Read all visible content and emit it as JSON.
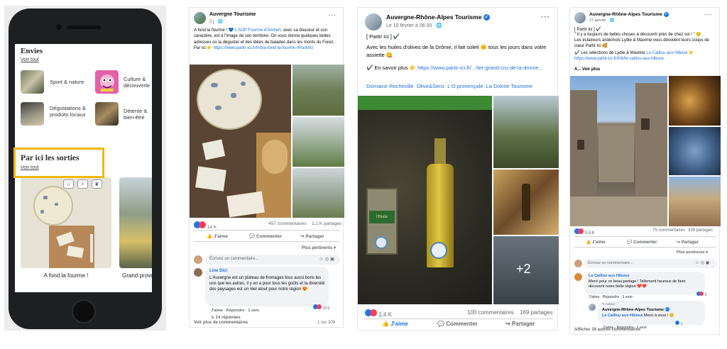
{
  "phone": {
    "section1_title": "Envies",
    "section1_link": "Voir tout",
    "categories": [
      {
        "label": "Sport & nature"
      },
      {
        "label": "Culture & découverte"
      },
      {
        "label": "Dégustations & produits locaux"
      },
      {
        "label": "Détente & bien-être"
      }
    ],
    "section2_title": "Par ici les sorties",
    "section2_link": "Voir tout",
    "card1_caption": "A fond la fourme !",
    "card2_caption": "Grand provença"
  },
  "post1": {
    "page_name": "Auvergne Tourisme",
    "date": "2 j · 🌐",
    "text_a": "A fond la fourme ! 💙 ",
    "text_link1": "L'AOP Fourme d'Ambert",
    "text_b": ", avec sa douceur et son caractère, est à l'image de son territoire. On vous donne quelques belles adresses où la déguster et des idées de balades dans les monts du Forez. Par ici 👉 ",
    "text_link2": "https://www.partir-ici.fr/fr/b/a-fond-la-fourme-#PartirIci",
    "reactions_count": "14 K",
    "comments": "457 commentaires",
    "shares": "1,1 K partages",
    "like": "J'aime",
    "comment": "Commenter",
    "share": "Partager",
    "sort": "Plus pertinents ▾",
    "write_placeholder": "Écrivez un commentaire...",
    "commenter": "Line Dici",
    "comment_text": "L'Auvergne est un plateau de fromages tous aussi bons les uns que les autres, il y en a pour tous les goûts et la diversité des paysages est un réel atout pour notre région 😍",
    "comment_actions": "J'aime · Répondre · 1 sem",
    "comment_react": "101",
    "replies": "↳ 14 réponses",
    "see_more": "Voir plus de commentaires",
    "pager": "1 sur 209"
  },
  "post2": {
    "page_name": "Auvergne-Rhône-Alpes Tourisme",
    "date": "Le 10 février à 06:30 · 🌐",
    "line1": "[ Partir Ici ] ✔️",
    "line2": "Avec les huiles d'olives de la Drôme, il fait soleil 🌞 tous les jours dans votre assiette 😋",
    "line3_a": "✔️ En savoir plus 👉 ",
    "line3_link": "https://www.partir-ici.fr/.../ter-grand-cru-de-la-drome...",
    "tags": "Domaine Rocheville  Olive&Sens  L'O provençale  La Drôme Tourisme",
    "bottle_label": "l'Huile",
    "more_photos": "+2",
    "reactions_count": "1,4 K",
    "comments": "100 commentaires",
    "shares": "169 partages",
    "like": "J'aime",
    "comment": "Commenter",
    "share": "Partager"
  },
  "post3": {
    "page_name": "Auvergne-Rhône-Alpes Tourisme",
    "date": "27 janvier · 🌐",
    "line1": "[ Partir Ici ] ✔️",
    "line2": "\" Il y a toujours de belles choses à découvrir près de chez soi ! \" 😊",
    "line3": "Les éclaireurs ardéchois Lydie & Maxime vous dévoilent leurs coups de cœur Partir Ici 🥰",
    "line4_a": "✔️ Les sélections de Lydie & Maxime ",
    "line4_link1": "Le Caillou aux Hiboux",
    "line4_b": " 👉",
    "line4_link2": "https://www.partir-ici.fr/fr/b/le-caillou-aux-hiboux",
    "see_more": "A... Voir plus",
    "reactions_count": "3,8 K",
    "comments": "75 commentaires",
    "shares": "339 partages",
    "like": "J'aime",
    "comment": "Commenter",
    "share": "Partager",
    "sort": "Plus pertinents ▾",
    "write_placeholder": "Écrivez un commentaire...",
    "commenter": "Le Caillou aux Hiboux",
    "comment_text": "Merci pour ce beau partage ! Tellement heureux de faire découvrir notre belle région ❤️❤️",
    "comment_actions": "J'aime · Répondre · 1 sem",
    "comment_react": "5",
    "reply_author_tag": "✎ Auteur",
    "reply_name": "Auvergne-Rhône-Alpes Tourisme",
    "reply_link": "Le Caillou aux Hiboux",
    "reply_text": " Merci à vous ! 😊",
    "reply_actions": "J'aime · Répondre · 1 sem",
    "reply_react": "2",
    "more_comments": "Afficher 19 autres commentaires"
  },
  "colors": {
    "facebook_blue": "#1877f2",
    "link_blue": "#216fdb",
    "highlight_yellow": "#f3b700"
  }
}
